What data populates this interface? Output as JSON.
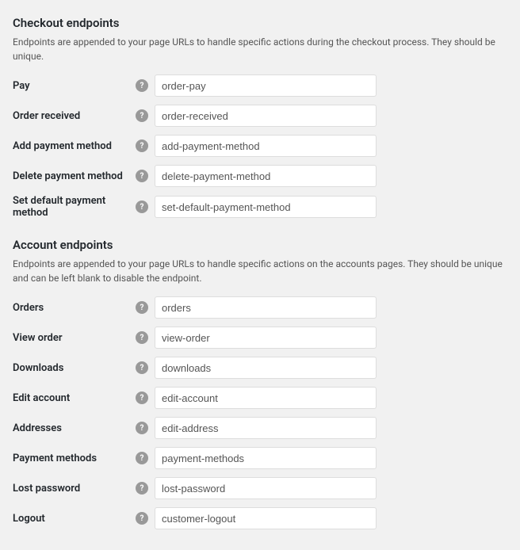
{
  "checkout_endpoints": {
    "title": "Checkout endpoints",
    "description": "Endpoints are appended to your page URLs to handle specific actions during the checkout process. They should be unique.",
    "fields": [
      {
        "label": "Pay",
        "value": "order-pay",
        "name": "pay-input"
      },
      {
        "label": "Order received",
        "value": "order-received",
        "name": "order-received-input"
      },
      {
        "label": "Add payment method",
        "value": "add-payment-method",
        "name": "add-payment-method-input"
      },
      {
        "label": "Delete payment method",
        "value": "delete-payment-method",
        "name": "delete-payment-method-input"
      },
      {
        "label": "Set default payment method",
        "value": "set-default-payment-method",
        "name": "set-default-payment-method-input"
      }
    ]
  },
  "account_endpoints": {
    "title": "Account endpoints",
    "description": "Endpoints are appended to your page URLs to handle specific actions on the accounts pages. They should be unique and can be left blank to disable the endpoint.",
    "fields": [
      {
        "label": "Orders",
        "value": "orders",
        "name": "orders-input"
      },
      {
        "label": "View order",
        "value": "view-order",
        "name": "view-order-input"
      },
      {
        "label": "Downloads",
        "value": "downloads",
        "name": "downloads-input"
      },
      {
        "label": "Edit account",
        "value": "edit-account",
        "name": "edit-account-input"
      },
      {
        "label": "Addresses",
        "value": "edit-address",
        "name": "addresses-input"
      },
      {
        "label": "Payment methods",
        "value": "payment-methods",
        "name": "payment-methods-input"
      },
      {
        "label": "Lost password",
        "value": "lost-password",
        "name": "lost-password-input"
      },
      {
        "label": "Logout",
        "value": "customer-logout",
        "name": "logout-input"
      }
    ]
  },
  "help_icon_label": "?"
}
